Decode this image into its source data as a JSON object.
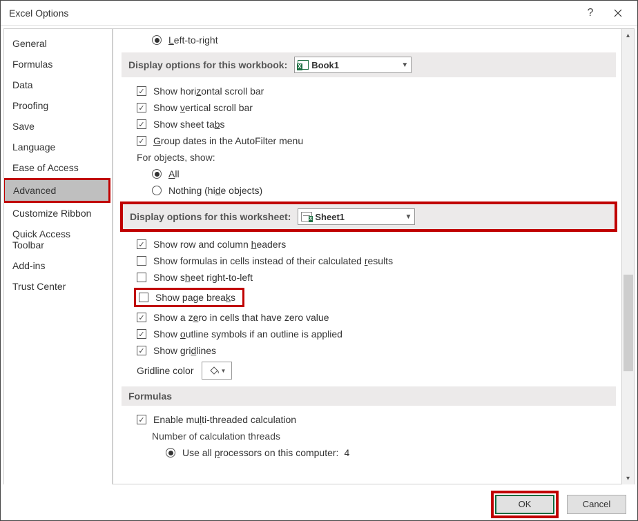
{
  "window": {
    "title": "Excel Options"
  },
  "sidebar": {
    "items": [
      "General",
      "Formulas",
      "Data",
      "Proofing",
      "Save",
      "Language",
      "Ease of Access",
      "Advanced",
      "Customize Ribbon",
      "Quick Access Toolbar",
      "Add-ins",
      "Trust Center"
    ],
    "selected": "Advanced"
  },
  "top_radio": {
    "label_pre": "L",
    "label_post": "eft-to-right"
  },
  "section_workbook": {
    "label": "Display options for this workbook:",
    "combo_value": "Book1"
  },
  "workbook_opts": {
    "hscroll": {
      "pre": "Show hori",
      "u": "z",
      "post": "ontal scroll bar"
    },
    "vscroll": {
      "pre": "Show ",
      "u": "v",
      "post": "ertical scroll bar"
    },
    "tabs": {
      "pre": "Show sheet ta",
      "u": "b",
      "post": "s"
    },
    "groupdates": {
      "pre": "",
      "u": "G",
      "post": "roup dates in the AutoFilter menu"
    },
    "forobjects": "For objects, show:",
    "all": {
      "u": "A",
      "post": "ll"
    },
    "nothing": {
      "pre": "Nothing (hi",
      "u": "d",
      "post": "e objects)"
    }
  },
  "section_worksheet": {
    "label": "Display options for this worksheet:",
    "combo_value": "Sheet1"
  },
  "worksheet_opts": {
    "headers": {
      "pre": "Show row and column ",
      "u": "h",
      "post": "eaders"
    },
    "formulas": {
      "pre": "Show formulas in cells instead of their calculated ",
      "u": "r",
      "post": "esults"
    },
    "rtl": {
      "pre": "Show s",
      "u": "h",
      "post": "eet right-to-left"
    },
    "pagebreaks": {
      "pre": "Show page brea",
      "u": "k",
      "post": "s"
    },
    "zero": {
      "pre": "Show a z",
      "u": "e",
      "post": "ro in cells that have zero value"
    },
    "outline": {
      "pre": "Show ",
      "u": "o",
      "post": "utline symbols if an outline is applied"
    },
    "gridlines": {
      "pre": "Show gri",
      "u": "d",
      "post": "lines"
    },
    "gridcolor": "Gridline color"
  },
  "section_formulas": {
    "label": "Formulas"
  },
  "formulas_opts": {
    "multi": {
      "pre": "Enable mu",
      "u": "l",
      "post": "ti-threaded calculation"
    },
    "threads_label": "Number of calculation threads",
    "useall": {
      "pre": "Use all ",
      "u": "p",
      "post": "rocessors on this computer:"
    },
    "useall_value": "4"
  },
  "buttons": {
    "ok": "OK",
    "cancel": "Cancel"
  }
}
